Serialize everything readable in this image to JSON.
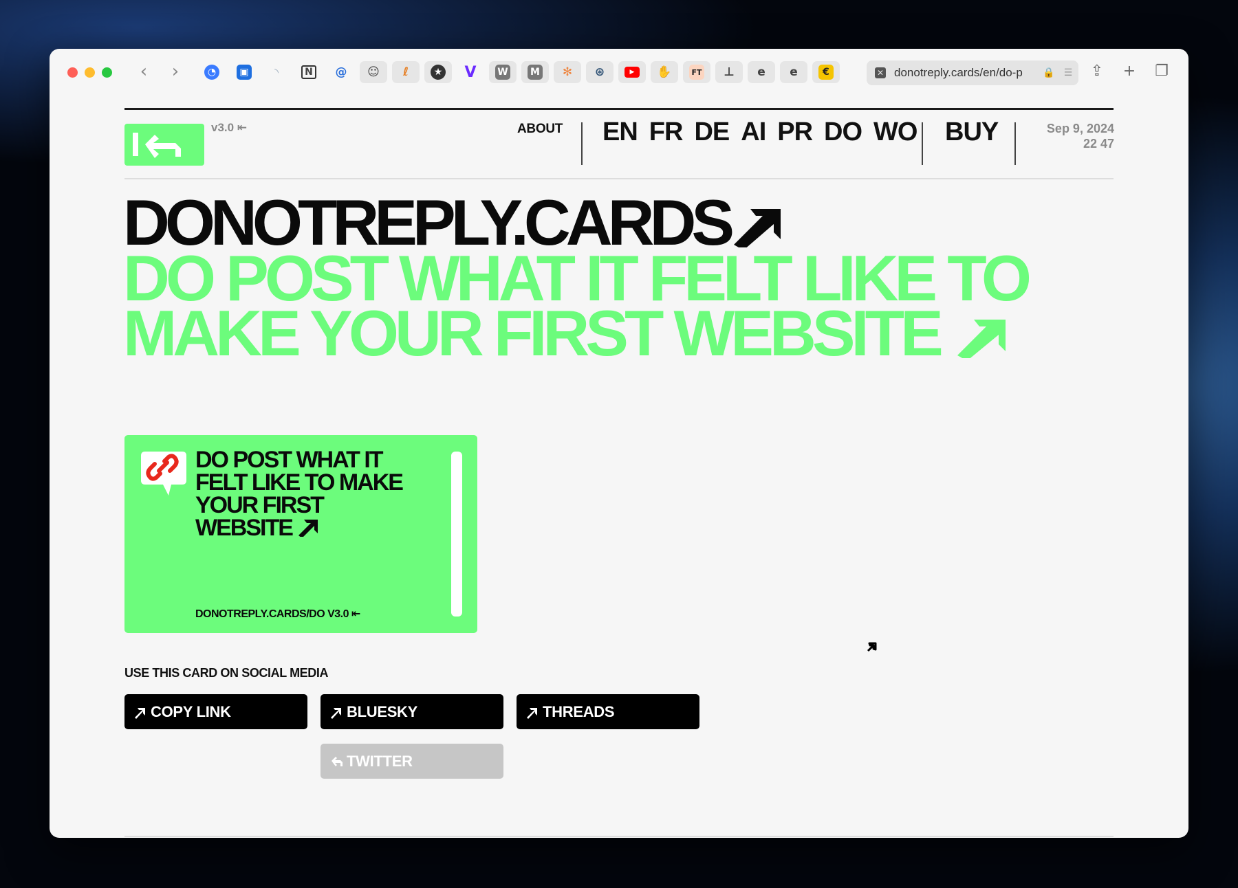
{
  "browser": {
    "url": "donotreply.cards/en/do-p",
    "bookmarks": [
      {
        "icon": "clock-logo-icon",
        "label": ""
      },
      {
        "icon": "bookmark-icon",
        "label": ""
      },
      {
        "icon": "rss-icon",
        "label": ""
      },
      {
        "icon": "notion-icon",
        "label": "N"
      },
      {
        "icon": "at-lock-icon",
        "label": ""
      },
      {
        "icon": "avatar-icon",
        "label": ""
      },
      {
        "icon": "swirl-icon",
        "label": ""
      },
      {
        "icon": "star-icon",
        "label": ""
      },
      {
        "icon": "v-logo-icon",
        "label": "V"
      },
      {
        "icon": "w-logo-icon",
        "label": "W"
      },
      {
        "icon": "m-logo-icon",
        "label": "M"
      },
      {
        "icon": "pinwheel-icon",
        "label": ""
      },
      {
        "icon": "globe-icon",
        "label": ""
      },
      {
        "icon": "youtube-icon",
        "label": ""
      },
      {
        "icon": "hand-icon",
        "label": ""
      },
      {
        "icon": "ft-logo-icon",
        "label": "FT"
      },
      {
        "icon": "lamp-icon",
        "label": ""
      },
      {
        "icon": "e-logo-icon",
        "label": "e"
      },
      {
        "icon": "e-logo-icon",
        "label": "e"
      },
      {
        "icon": "coin-icon",
        "label": ""
      }
    ]
  },
  "header": {
    "version": "v3.0 ⇤",
    "about": "ABOUT",
    "languages": [
      "EN",
      "FR",
      "DE",
      "AI",
      "PR",
      "DO",
      "WO"
    ],
    "buy": "BUY",
    "date": "Sep 9, 2024",
    "time": "22 47"
  },
  "hero": {
    "title": "DONOTREPLY.CARDS",
    "subtitle": "DO POST WHAT IT FELT LIKE TO MAKE YOUR FIRST WEBSITE"
  },
  "card": {
    "title": "DO POST WHAT IT FELT LIKE TO MAKE YOUR FIRST WEBSITE",
    "footer": "DONOTREPLY.CARDS/DO V3.0 ⇤"
  },
  "share": {
    "label": "USE THIS CARD ON SOCIAL MEDIA",
    "buttons": [
      {
        "label": "COPY LINK",
        "enabled": true
      },
      {
        "label": "BLUESKY",
        "enabled": true
      },
      {
        "label": "THREADS",
        "enabled": true
      },
      {
        "label": "TWITTER",
        "enabled": false
      }
    ]
  },
  "colors": {
    "accent": "#6cfc7c",
    "text": "#0a0a0a",
    "background": "#f6f6f6",
    "disabled": "#c6c6c6"
  }
}
